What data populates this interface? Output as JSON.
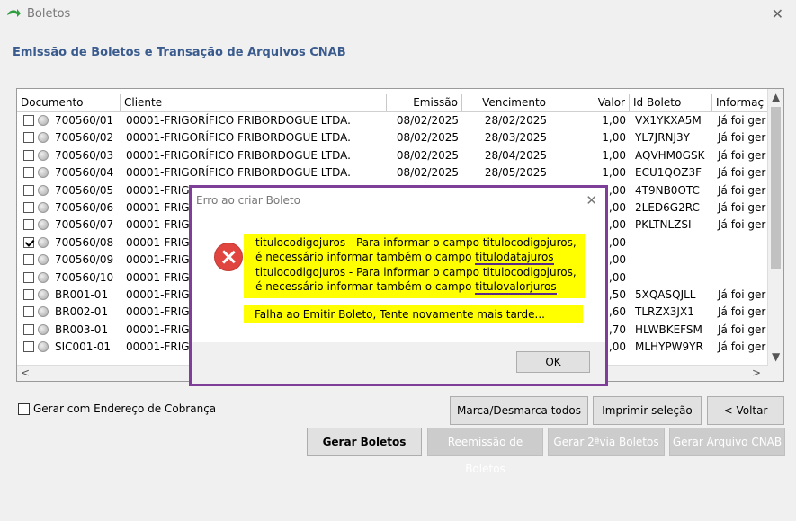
{
  "window": {
    "title": "Boletos",
    "close_icon": "close-icon",
    "app_icon": "green-arrow-icon"
  },
  "header": {
    "title": "Emissão de Boletos e Transação de Arquivos CNAB"
  },
  "grid": {
    "columns": [
      "Documento",
      "Cliente",
      "Emissão",
      "Vencimento",
      "Valor",
      "Id Boleto",
      "Informaç"
    ],
    "rows": [
      {
        "checked": false,
        "documento": "700560/01",
        "cliente": "00001-FRIGORÍFICO FRIBORDOGUE LTDA.",
        "emissao": "08/02/2025",
        "vencimento": "28/02/2025",
        "valor": "1,00",
        "id_boleto": "VX1YKXA5M",
        "info": "Já foi ger"
      },
      {
        "checked": false,
        "documento": "700560/02",
        "cliente": "00001-FRIGORÍFICO FRIBORDOGUE LTDA.",
        "emissao": "08/02/2025",
        "vencimento": "28/03/2025",
        "valor": "1,00",
        "id_boleto": "YL7JRNJ3Y",
        "info": "Já foi ger"
      },
      {
        "checked": false,
        "documento": "700560/03",
        "cliente": "00001-FRIGORÍFICO FRIBORDOGUE LTDA.",
        "emissao": "08/02/2025",
        "vencimento": "28/04/2025",
        "valor": "1,00",
        "id_boleto": "AQVHM0GSK",
        "info": "Já foi ger"
      },
      {
        "checked": false,
        "documento": "700560/04",
        "cliente": "00001-FRIGORÍFICO FRIBORDOGUE LTDA.",
        "emissao": "08/02/2025",
        "vencimento": "28/05/2025",
        "valor": "1,00",
        "id_boleto": "ECU1QOZ3F",
        "info": "Já foi ger"
      },
      {
        "checked": false,
        "documento": "700560/05",
        "cliente": "00001-FRIGO",
        "emissao": "",
        "vencimento": "",
        "valor": ",00",
        "id_boleto": "4T9NB0OTC",
        "info": "Já foi ger"
      },
      {
        "checked": false,
        "documento": "700560/06",
        "cliente": "00001-FRIGO",
        "emissao": "",
        "vencimento": "",
        "valor": ",00",
        "id_boleto": "2LED6G2RC",
        "info": "Já foi ger"
      },
      {
        "checked": false,
        "documento": "700560/07",
        "cliente": "00001-FRIGO",
        "emissao": "",
        "vencimento": "",
        "valor": ",00",
        "id_boleto": "PKLTNLZSI",
        "info": "Já foi ger"
      },
      {
        "checked": true,
        "documento": "700560/08",
        "cliente": "00001-FRIGO",
        "emissao": "",
        "vencimento": "",
        "valor": ",00",
        "id_boleto": "",
        "info": ""
      },
      {
        "checked": false,
        "documento": "700560/09",
        "cliente": "00001-FRIGO",
        "emissao": "",
        "vencimento": "",
        "valor": ",00",
        "id_boleto": "",
        "info": ""
      },
      {
        "checked": false,
        "documento": "700560/10",
        "cliente": "00001-FRIGO",
        "emissao": "",
        "vencimento": "",
        "valor": ",00",
        "id_boleto": "",
        "info": ""
      },
      {
        "checked": false,
        "documento": "BR001-01",
        "cliente": "00001-FRIGO",
        "emissao": "",
        "vencimento": "",
        "valor": ",50",
        "id_boleto": "5XQASQJLL",
        "info": "Já foi ger"
      },
      {
        "checked": false,
        "documento": "BR002-01",
        "cliente": "00001-FRIGO",
        "emissao": "",
        "vencimento": "",
        "valor": ",60",
        "id_boleto": "TLRZX3JX1",
        "info": "Já foi ger"
      },
      {
        "checked": false,
        "documento": "BR003-01",
        "cliente": "00001-FRIGO",
        "emissao": "",
        "vencimento": "",
        "valor": ",70",
        "id_boleto": "HLWBKEFSM",
        "info": "Já foi ger"
      },
      {
        "checked": false,
        "documento": "SIC001-01",
        "cliente": "00001-FRIGO",
        "emissao": "",
        "vencimento": "",
        "valor": ",00",
        "id_boleto": "MLHYPW9YR",
        "info": "Já foi ger"
      }
    ]
  },
  "options": {
    "gerar_endereco_cobranca": "Gerar com Endereço de Cobrança"
  },
  "buttons": {
    "marca_desmarca": "Marca/Desmarca todos",
    "imprimir_selecao": "Imprimir seleção",
    "voltar": "< Voltar",
    "gerar_boletos": "Gerar Boletos",
    "reemissao": "Reemissão de Boletos",
    "segunda_via": "Gerar 2ªvia Boletos",
    "arquivo_cnab": "Gerar Arquivo CNAB"
  },
  "dialog": {
    "title": "Erro ao criar Boleto",
    "icon": "error-icon",
    "message_lines": [
      "titulocodigojuros - Para informar o campo titulocodigojuros,",
      "é necessário informar também o campo ",
      "titulodatajuros",
      "titulocodigojuros - Para informar o campo titulocodigojuros,",
      "é necessário informar também o campo ",
      "titulovalorjuros"
    ],
    "failure": "Falha ao Emitir Boleto, Tente novamente mais tarde...",
    "ok": "OK"
  }
}
